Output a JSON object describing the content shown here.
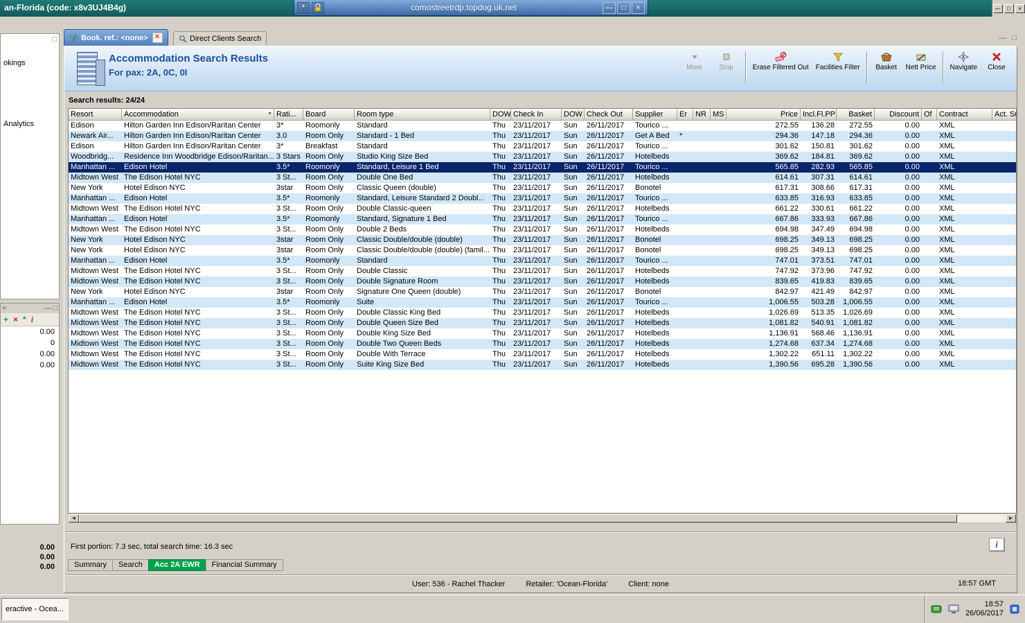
{
  "colors": {
    "selection": "#0a246a",
    "row_alt": "#d3e7f7",
    "accent_green": "#00a14b",
    "title_blue": "#1a4f9c",
    "titlebar_teal": "#1b6e6d",
    "rdp_blue": "#4f7cba"
  },
  "icons": {
    "minimize": "—",
    "restore": "❐",
    "maximize": "□",
    "close": "×",
    "close_tab": "×",
    "filter": "▼",
    "info": "i",
    "arrow_left": "◄",
    "arrow_right": "►",
    "pin": "pin",
    "lock": "lock"
  },
  "window": {
    "app_title": "an-Florida (code: x8v3UJ4B4g)",
    "rdp_title": "comostreetrdp.topdog.uk.net"
  },
  "sidebar": {
    "items": [
      "okings",
      "Analytics"
    ],
    "panel_values": [
      "0.00",
      "0",
      "0.00",
      "0.00"
    ],
    "panel_tools": [
      "sync",
      "delete",
      "new",
      "info"
    ],
    "totals": [
      "0.00",
      "0.00",
      "0.00"
    ]
  },
  "tabs": [
    {
      "label": "Book. ref.: <none>",
      "active": true
    },
    {
      "label": "Direct Clients Search",
      "active": false
    }
  ],
  "header": {
    "title": "Accommodation Search Results",
    "subtitle": "For pax: 2A, 0C, 0I"
  },
  "toolbar": {
    "buttons": [
      {
        "label": "More",
        "disabled": true
      },
      {
        "label": "Stop",
        "disabled": true
      },
      {
        "label": "Erase Filtered Out",
        "disabled": false
      },
      {
        "label": "Facilities Filter",
        "disabled": false
      },
      {
        "label": "Basket",
        "disabled": false
      },
      {
        "label": "Nett Price",
        "disabled": false
      },
      {
        "label": "Navigate",
        "disabled": false
      },
      {
        "label": "Close",
        "disabled": false
      }
    ]
  },
  "results_label": "Search results: 24/24",
  "table": {
    "selected_index": 4,
    "columns": [
      "Resort",
      "Accommodation",
      "Rati...",
      "Board",
      "Room type",
      "DOW",
      "Check In",
      "DOW",
      "Check Out",
      "Supplier",
      "Er",
      "NR",
      "MS",
      "Price",
      "Incl.Fl.PP",
      "Basket",
      "Discount",
      "Of",
      "Contract",
      "Act. Supplier"
    ],
    "rows": [
      [
        "Edison",
        "Hilton Garden Inn Edison/Raritan Center",
        "3*",
        "Roomonly",
        "Standard",
        "Thu",
        "23/11/2017",
        "Sun",
        "26/11/2017",
        "Tourico ...",
        "",
        "",
        "",
        "272.55",
        "136.28",
        "272.55",
        "0.00",
        "",
        "XML",
        ""
      ],
      [
        "Newark Air...",
        "Hilton Garden Inn Edison/Raritan Center",
        "3.0",
        "Room Only",
        "Standard - 1 Bed",
        "Thu",
        "23/11/2017",
        "Sun",
        "26/11/2017",
        "Get A Bed",
        "*",
        "",
        "",
        "294.36",
        "147.18",
        "294.36",
        "0.00",
        "",
        "XML",
        ""
      ],
      [
        "Edison",
        "Hilton Garden Inn Edison/Raritan Center",
        "3*",
        "Breakfast",
        "Standard",
        "Thu",
        "23/11/2017",
        "Sun",
        "26/11/2017",
        "Tourico ...",
        "",
        "",
        "",
        "301.62",
        "150.81",
        "301.62",
        "0.00",
        "",
        "XML",
        ""
      ],
      [
        "Woodbridg...",
        "Residence Inn Woodbridge Edison/Raritan...",
        "3 Stars",
        "Room Only",
        "Studio King Size Bed",
        "Thu",
        "23/11/2017",
        "Sun",
        "26/11/2017",
        "Hotelbeds",
        "",
        "",
        "",
        "369.62",
        "184.81",
        "369.62",
        "0.00",
        "",
        "XML",
        ""
      ],
      [
        "Manhattan ...",
        "Edison Hotel",
        "3.5*",
        "Roomonly",
        "Standard, Leisure 1 Bed",
        "Thu",
        "23/11/2017",
        "Sun",
        "26/11/2017",
        "Tourico ...",
        "",
        "",
        "",
        "565.85",
        "282.93",
        "565.85",
        "0.00",
        "",
        "XML",
        ""
      ],
      [
        "Midtown West",
        "The Edison Hotel NYC",
        "3 St...",
        "Room Only",
        "Double One Bed",
        "Thu",
        "23/11/2017",
        "Sun",
        "26/11/2017",
        "Hotelbeds",
        "",
        "",
        "",
        "614.61",
        "307.31",
        "614.61",
        "0.00",
        "",
        "XML",
        ""
      ],
      [
        "New York",
        "Hotel Edison NYC",
        "3star",
        "Room Only",
        "Classic Queen (double)",
        "Thu",
        "23/11/2017",
        "Sun",
        "26/11/2017",
        "Bonotel",
        "",
        "",
        "",
        "617.31",
        "308.66",
        "617.31",
        "0.00",
        "",
        "XML",
        ""
      ],
      [
        "Manhattan ...",
        "Edison Hotel",
        "3.5*",
        "Roomonly",
        "Standard, Leisure Standard 2 Doubl...",
        "Thu",
        "23/11/2017",
        "Sun",
        "26/11/2017",
        "Tourico ...",
        "",
        "",
        "",
        "633.85",
        "316.93",
        "633.85",
        "0.00",
        "",
        "XML",
        ""
      ],
      [
        "Midtown West",
        "The Edison Hotel NYC",
        "3 St...",
        "Room Only",
        "Double Classic-queen",
        "Thu",
        "23/11/2017",
        "Sun",
        "26/11/2017",
        "Hotelbeds",
        "",
        "",
        "",
        "661.22",
        "330.61",
        "661.22",
        "0.00",
        "",
        "XML",
        ""
      ],
      [
        "Manhattan ...",
        "Edison Hotel",
        "3.5*",
        "Roomonly",
        "Standard, Signature 1 Bed",
        "Thu",
        "23/11/2017",
        "Sun",
        "26/11/2017",
        "Tourico ...",
        "",
        "",
        "",
        "667.86",
        "333.93",
        "667.86",
        "0.00",
        "",
        "XML",
        ""
      ],
      [
        "Midtown West",
        "The Edison Hotel NYC",
        "3 St...",
        "Room Only",
        "Double 2 Beds",
        "Thu",
        "23/11/2017",
        "Sun",
        "26/11/2017",
        "Hotelbeds",
        "",
        "",
        "",
        "694.98",
        "347.49",
        "694.98",
        "0.00",
        "",
        "XML",
        ""
      ],
      [
        "New York",
        "Hotel Edison NYC",
        "3star",
        "Room Only",
        "Classic Double/double (double)",
        "Thu",
        "23/11/2017",
        "Sun",
        "26/11/2017",
        "Bonotel",
        "",
        "",
        "",
        "698.25",
        "349.13",
        "698.25",
        "0.00",
        "",
        "XML",
        ""
      ],
      [
        "New York",
        "Hotel Edison NYC",
        "3star",
        "Room Only",
        "Classic Double/double (double) (famil...",
        "Thu",
        "23/11/2017",
        "Sun",
        "26/11/2017",
        "Bonotel",
        "",
        "",
        "",
        "698.25",
        "349.13",
        "698.25",
        "0.00",
        "",
        "XML",
        ""
      ],
      [
        "Manhattan ...",
        "Edison Hotel",
        "3.5*",
        "Roomonly",
        "Standard",
        "Thu",
        "23/11/2017",
        "Sun",
        "26/11/2017",
        "Tourico ...",
        "",
        "",
        "",
        "747.01",
        "373.51",
        "747.01",
        "0.00",
        "",
        "XML",
        ""
      ],
      [
        "Midtown West",
        "The Edison Hotel NYC",
        "3 St...",
        "Room Only",
        "Double Classic",
        "Thu",
        "23/11/2017",
        "Sun",
        "26/11/2017",
        "Hotelbeds",
        "",
        "",
        "",
        "747.92",
        "373.96",
        "747.92",
        "0.00",
        "",
        "XML",
        ""
      ],
      [
        "Midtown West",
        "The Edison Hotel NYC",
        "3 St...",
        "Room Only",
        "Double Signature Room",
        "Thu",
        "23/11/2017",
        "Sun",
        "26/11/2017",
        "Hotelbeds",
        "",
        "",
        "",
        "839.65",
        "419.83",
        "839.65",
        "0.00",
        "",
        "XML",
        ""
      ],
      [
        "New York",
        "Hotel Edison NYC",
        "3star",
        "Room Only",
        "Signature One Queen (double)",
        "Thu",
        "23/11/2017",
        "Sun",
        "26/11/2017",
        "Bonotel",
        "",
        "",
        "",
        "842.97",
        "421.49",
        "842.97",
        "0.00",
        "",
        "XML",
        ""
      ],
      [
        "Manhattan ...",
        "Edison Hotel",
        "3.5*",
        "Roomonly",
        "Suite",
        "Thu",
        "23/11/2017",
        "Sun",
        "26/11/2017",
        "Tourico ...",
        "",
        "",
        "",
        "1,006.55",
        "503.28",
        "1,006.55",
        "0.00",
        "",
        "XML",
        ""
      ],
      [
        "Midtown West",
        "The Edison Hotel NYC",
        "3 St...",
        "Room Only",
        "Double Classic King Bed",
        "Thu",
        "23/11/2017",
        "Sun",
        "26/11/2017",
        "Hotelbeds",
        "",
        "",
        "",
        "1,026.69",
        "513.35",
        "1,026.69",
        "0.00",
        "",
        "XML",
        ""
      ],
      [
        "Midtown West",
        "The Edison Hotel NYC",
        "3 St...",
        "Room Only",
        "Double Queen Size Bed",
        "Thu",
        "23/11/2017",
        "Sun",
        "26/11/2017",
        "Hotelbeds",
        "",
        "",
        "",
        "1,081.82",
        "540.91",
        "1,081.82",
        "0.00",
        "",
        "XML",
        ""
      ],
      [
        "Midtown West",
        "The Edison Hotel NYC",
        "3 St...",
        "Room Only",
        "Double King Size Bed",
        "Thu",
        "23/11/2017",
        "Sun",
        "26/11/2017",
        "Hotelbeds",
        "",
        "",
        "",
        "1,136.91",
        "568.46",
        "1,136.91",
        "0.00",
        "",
        "XML",
        ""
      ],
      [
        "Midtown West",
        "The Edison Hotel NYC",
        "3 St...",
        "Room Only",
        "Double Two Queen Beds",
        "Thu",
        "23/11/2017",
        "Sun",
        "26/11/2017",
        "Hotelbeds",
        "",
        "",
        "",
        "1,274.68",
        "637.34",
        "1,274.68",
        "0.00",
        "",
        "XML",
        ""
      ],
      [
        "Midtown West",
        "The Edison Hotel NYC",
        "3 St...",
        "Room Only",
        "Double With Terrace",
        "Thu",
        "23/11/2017",
        "Sun",
        "26/11/2017",
        "Hotelbeds",
        "",
        "",
        "",
        "1,302.22",
        "651.11",
        "1,302.22",
        "0.00",
        "",
        "XML",
        ""
      ],
      [
        "Midtown West",
        "The Edison Hotel NYC",
        "3 St...",
        "Room Only",
        "Suite King Size Bed",
        "Thu",
        "23/11/2017",
        "Sun",
        "26/11/2017",
        "Hotelbeds",
        "",
        "",
        "",
        "1,390.56",
        "695.28",
        "1,390.56",
        "0.00",
        "",
        "XML",
        ""
      ]
    ]
  },
  "footer": {
    "timing": "First portion: 7.3 sec, total search time: 16.3 sec",
    "tabs": [
      {
        "label": "Summary",
        "active": false
      },
      {
        "label": "Search",
        "active": false
      },
      {
        "label": "Acc 2A EWR",
        "active": true
      },
      {
        "label": "Financial Summary",
        "active": false
      }
    ]
  },
  "statusbar": {
    "user": "User: 536 - Rachel Thacker",
    "retailer": "Retailer: 'Ocean-Florida'",
    "client": "Client: none",
    "time": "18:57 GMT"
  },
  "taskbar": {
    "window_button": "eractive - Ocea...",
    "clock_time": "18:57",
    "clock_date": "26/06/2017"
  }
}
